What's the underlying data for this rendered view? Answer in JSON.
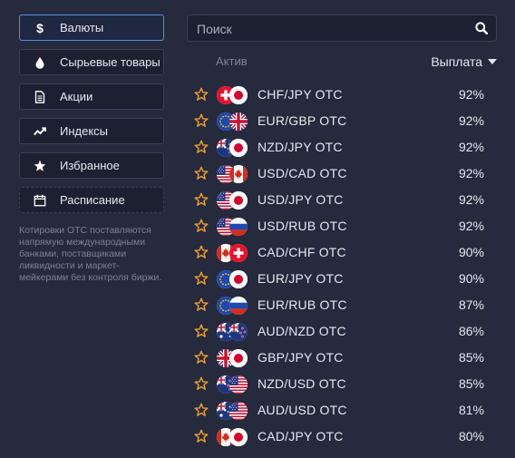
{
  "categories": [
    {
      "label": "Валюты",
      "icon": "dollar-icon",
      "active": true
    },
    {
      "label": "Сырьевые товары",
      "icon": "drop-icon"
    },
    {
      "label": "Акции",
      "icon": "document-icon"
    },
    {
      "label": "Индексы",
      "icon": "trend-icon"
    },
    {
      "label": "Избранное",
      "icon": "star-icon"
    },
    {
      "label": "Расписание",
      "icon": "calendar-icon"
    }
  ],
  "note": "Котировки OTC поставляются напрямую международными банками, поставщиками ликвидности и маркет-мейкерами без контроля биржи.",
  "search": {
    "placeholder": "Поиск"
  },
  "table": {
    "asset_header": "Актив",
    "payout_header": "Выплата"
  },
  "assets": [
    {
      "name": "CHF/JPY OTC",
      "payout": "92%",
      "flags": [
        "ch",
        "jp"
      ]
    },
    {
      "name": "EUR/GBP OTC",
      "payout": "92%",
      "flags": [
        "eu",
        "gb"
      ]
    },
    {
      "name": "NZD/JPY OTC",
      "payout": "92%",
      "flags": [
        "nz",
        "jp"
      ]
    },
    {
      "name": "USD/CAD OTC",
      "payout": "92%",
      "flags": [
        "us",
        "ca"
      ]
    },
    {
      "name": "USD/JPY OTC",
      "payout": "92%",
      "flags": [
        "us",
        "jp"
      ]
    },
    {
      "name": "USD/RUB OTC",
      "payout": "92%",
      "flags": [
        "us",
        "ru"
      ]
    },
    {
      "name": "CAD/CHF OTC",
      "payout": "90%",
      "flags": [
        "ca",
        "ch"
      ]
    },
    {
      "name": "EUR/JPY OTC",
      "payout": "90%",
      "flags": [
        "eu",
        "jp"
      ]
    },
    {
      "name": "EUR/RUB OTC",
      "payout": "87%",
      "flags": [
        "eu",
        "ru"
      ]
    },
    {
      "name": "AUD/NZD OTC",
      "payout": "86%",
      "flags": [
        "au",
        "nz"
      ]
    },
    {
      "name": "GBP/JPY OTC",
      "payout": "85%",
      "flags": [
        "gb",
        "jp"
      ]
    },
    {
      "name": "NZD/USD OTC",
      "payout": "85%",
      "flags": [
        "nz",
        "us"
      ]
    },
    {
      "name": "AUD/USD OTC",
      "payout": "81%",
      "flags": [
        "au",
        "us"
      ]
    },
    {
      "name": "CAD/JPY OTC",
      "payout": "80%",
      "flags": [
        "ca",
        "jp"
      ]
    }
  ],
  "colors": {
    "accent": "#4d8fe6",
    "star": "#f0a030",
    "background": "#262a3d"
  }
}
